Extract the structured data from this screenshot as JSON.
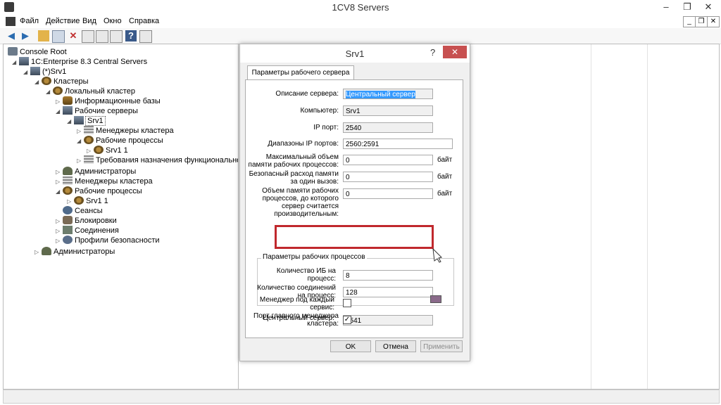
{
  "window": {
    "title": "1CV8 Servers",
    "minimize": "–",
    "restore": "❐",
    "close": "✕"
  },
  "menu": [
    "Файл",
    "Действие",
    "Вид",
    "Окно",
    "Справка"
  ],
  "inner_buttons": [
    "_",
    "❐",
    "✕"
  ],
  "tree": {
    "root": "Console Root",
    "central": "1C:Enterprise 8.3 Central Servers",
    "srv": "(*)Srv1",
    "clusters": "Кластеры",
    "local_cluster": "Локальный кластер",
    "infobases": "Информационные базы",
    "work_servers": "Рабочие серверы",
    "srv1": "Srv1",
    "cluster_managers": "Менеджеры кластера",
    "work_processes": "Рабочие процессы",
    "srv1_1": "Srv1 1",
    "requirements": "Требования назначения функциональности",
    "admins": "Администраторы",
    "cluster_managers2": "Менеджеры кластера",
    "work_processes2": "Рабочие процессы",
    "srv1_1b": "Srv1 1",
    "sessions": "Сеансы",
    "locks": "Блокировки",
    "connections": "Соединения",
    "security_profiles": "Профили безопасности",
    "admins_root": "Администраторы"
  },
  "dialog": {
    "title": "Srv1",
    "help": "?",
    "close": "✕",
    "tab": "Параметры рабочего сервера",
    "fields": {
      "description": {
        "label": "Описание сервера:",
        "value": "Центральный сервер"
      },
      "computer": {
        "label": "Компьютер:",
        "value": "Srv1"
      },
      "ip_port": {
        "label": "IP порт:",
        "value": "2540"
      },
      "ip_range": {
        "label": "Диапазоны IP портов:",
        "value": "2560:2591"
      },
      "max_memory": {
        "label": "Максимальный объем памяти рабочих процессов:",
        "value": "0",
        "unit": "байт"
      },
      "safe_call": {
        "label": "Безопасный расход памяти за один вызов:",
        "value": "0",
        "unit": "байт"
      },
      "memory_threshold": {
        "label": "Объем памяти рабочих процессов, до которого сервер считается производительным:",
        "value": "0",
        "unit": "байт"
      }
    },
    "group": {
      "title": "Параметры рабочих процессов",
      "ib_per_process": {
        "label": "Количество ИБ на процесс:",
        "value": "8"
      },
      "conn_per_process": {
        "label": "Количество соединений на процесс:",
        "value": "128"
      }
    },
    "main_manager_port": {
      "label": "Порт главного менеджера кластера:",
      "value": "2541"
    },
    "manager_per_service": {
      "label": "Менеджер под каждый сервис:",
      "checked": false
    },
    "central_server": {
      "label": "Центральный сервер:",
      "checked": true,
      "mark": "✓"
    },
    "buttons": {
      "ok": "OK",
      "cancel": "Отмена",
      "apply": "Применить"
    }
  },
  "colors": {
    "highlight_box": "#c0282d",
    "close_button": "#c75050"
  }
}
